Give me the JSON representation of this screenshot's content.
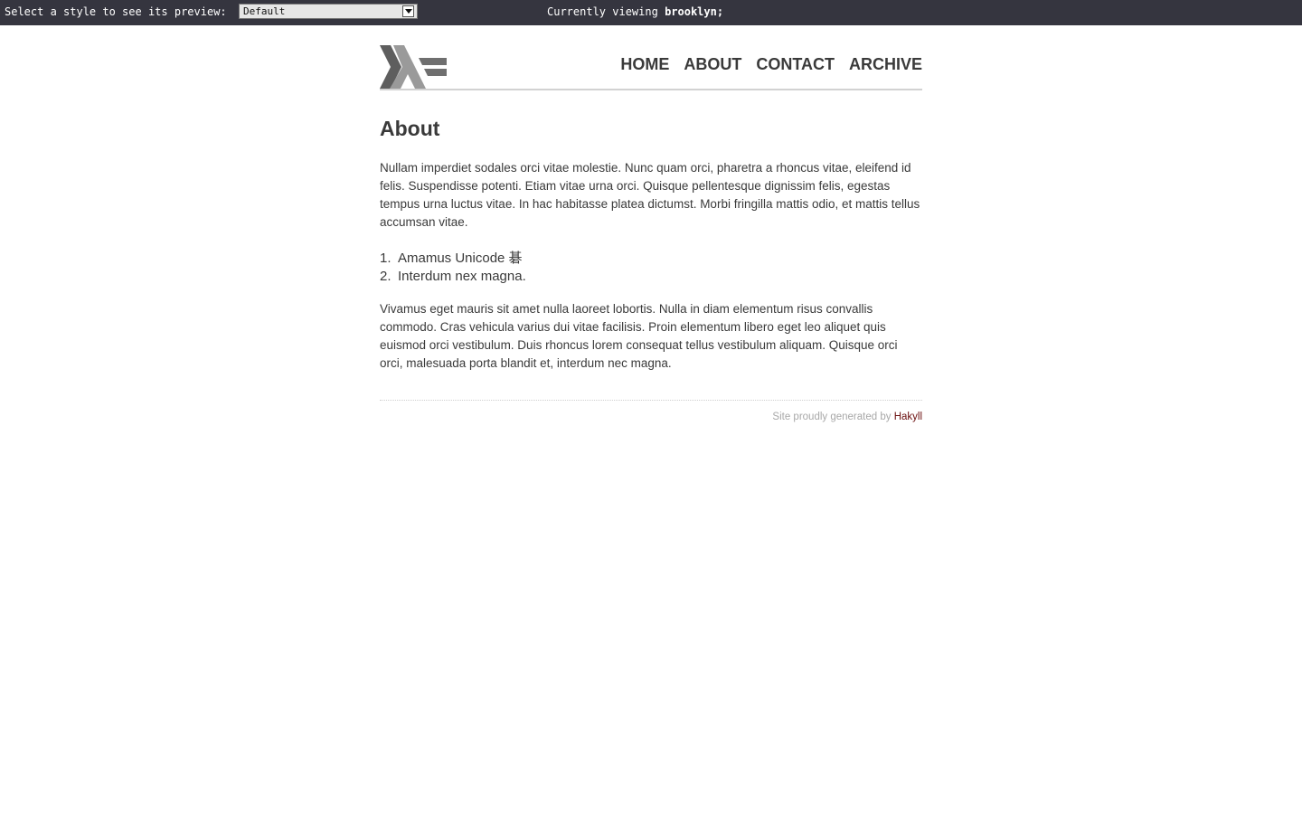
{
  "topbar": {
    "prompt": "Select a style to see its preview:",
    "style_select_value": "Default",
    "viewing_prefix": "Currently viewing",
    "viewing_name": "brooklyn;"
  },
  "site": {
    "logo_icon": "haskell-logo-icon",
    "nav": [
      "HOME",
      "ABOUT",
      "CONTACT",
      "ARCHIVE"
    ]
  },
  "page": {
    "title": "About",
    "paragraph1": "Nullam imperdiet sodales orci vitae molestie. Nunc quam orci, pharetra a rhoncus vitae, eleifend id felis. Suspendisse potenti. Etiam vitae urna orci. Quisque pellentesque dignissim felis, egestas tempus urna luctus vitae. In hac habitasse platea dictumst. Morbi fringilla mattis odio, et mattis tellus accumsan vitae.",
    "list": [
      {
        "num": "1.",
        "text": "Amamus Unicode 碁"
      },
      {
        "num": "2.",
        "text": "Interdum nex magna."
      }
    ],
    "paragraph2": "Vivamus eget mauris sit amet nulla laoreet lobortis. Nulla in diam elementum risus convallis commodo. Cras vehicula varius dui vitae facilisis. Proin elementum libero eget leo aliquet quis euismod orci vestibulum. Duis rhoncus lorem consequat tellus vestibulum aliquam. Quisque orci orci, malesuada porta blandit et, interdum nec magna."
  },
  "footer": {
    "text": "Site proudly generated by",
    "link": "Hakyll"
  },
  "colors": {
    "topbar_bg": "#35353f",
    "text": "#3a3a3a",
    "footer_link": "#6b0f0f"
  }
}
